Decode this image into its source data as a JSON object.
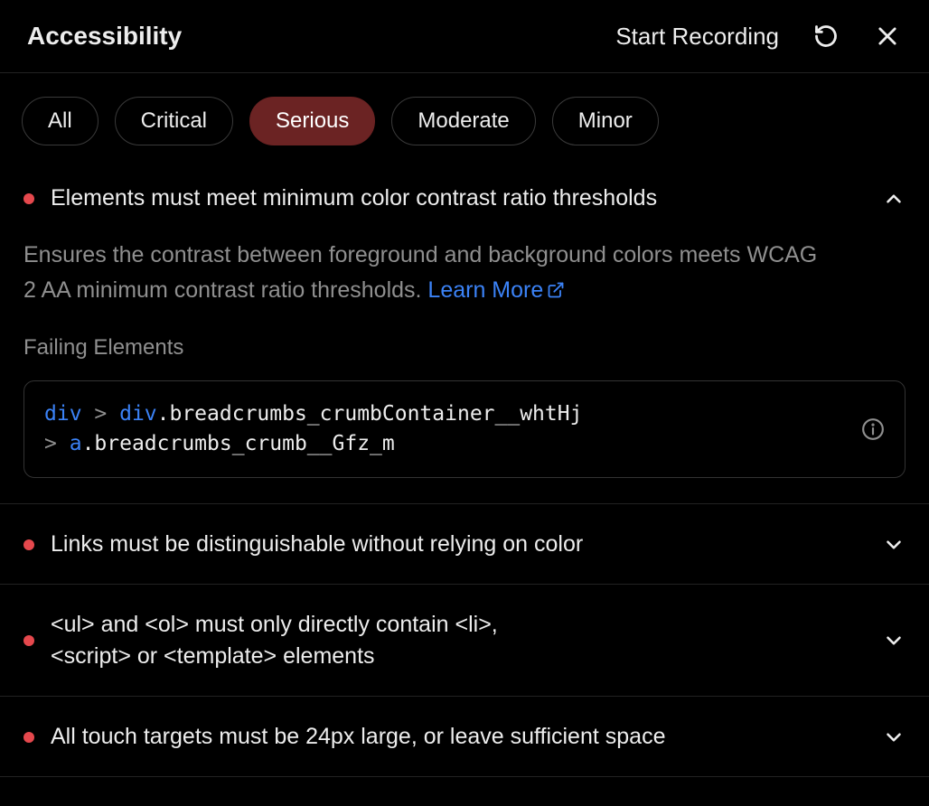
{
  "header": {
    "title": "Accessibility",
    "start_recording": "Start Recording"
  },
  "filters": {
    "items": [
      {
        "label": "All",
        "active": false
      },
      {
        "label": "Critical",
        "active": false
      },
      {
        "label": "Serious",
        "active": true
      },
      {
        "label": "Moderate",
        "active": false
      },
      {
        "label": "Minor",
        "active": false
      }
    ]
  },
  "issues": [
    {
      "title": "Elements must meet minimum color contrast ratio thresholds",
      "expanded": true,
      "description": "Ensures the contrast between foreground and background colors meets WCAG 2 AA minimum contrast ratio thresholds.",
      "learn_more": "Learn More",
      "failing_label": "Failing Elements",
      "selector": {
        "t1": "div",
        "p1": " > ",
        "t2": "div",
        "c2": ".breadcrumbs_crumbContainer__whtHj",
        "p2": "> ",
        "t3": "a",
        "c3": ".breadcrumbs_crumb__Gfz_m"
      }
    },
    {
      "title": "Links must be distinguishable without relying on color",
      "expanded": false
    },
    {
      "title": "<ul> and <ol> must only directly contain <li>, <script> or <template> elements",
      "expanded": false
    },
    {
      "title": "All touch targets must be 24px large, or leave sufficient space",
      "expanded": false
    }
  ]
}
